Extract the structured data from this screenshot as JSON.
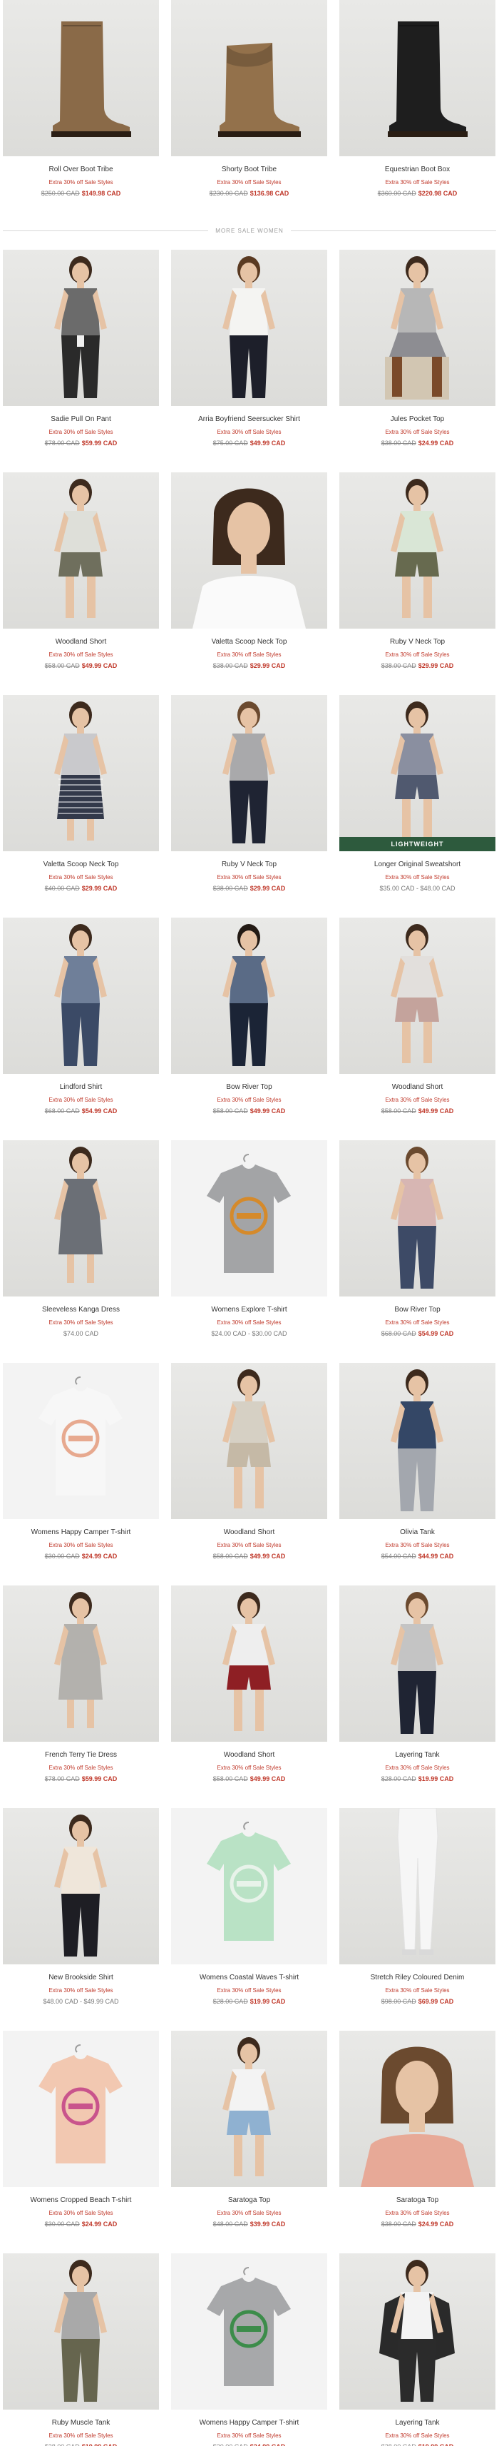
{
  "top_row": [
    {
      "name": "Roll Over Boot Tribe",
      "promo": "Extra 30% off Sale Styles",
      "was": "$250.00 CAD",
      "now": "$149.98 CAD",
      "image": "boot-brown"
    },
    {
      "name": "Shorty Boot Tribe",
      "promo": "Extra 30% off Sale Styles",
      "was": "$230.00 CAD",
      "now": "$136.98 CAD",
      "image": "boot-brown-short"
    },
    {
      "name": "Equestrian Boot Box",
      "promo": "Extra 30% off Sale Styles",
      "was": "$360.00 CAD",
      "now": "$220.98 CAD",
      "image": "boot-black"
    }
  ],
  "section_divider": "MORE SALE WOMEN",
  "products": [
    {
      "name": "Sadie Pull On Pant",
      "promo": "Extra 30% off Sale Styles",
      "was": "$78.00 CAD",
      "now": "$59.99 CAD",
      "image": "pant-black"
    },
    {
      "name": "Arria Boyfriend Seersucker Shirt",
      "promo": "Extra 30% off Sale Styles",
      "was": "$75.00 CAD",
      "now": "$49.99 CAD",
      "image": "shirt-white"
    },
    {
      "name": "Jules Pocket Top",
      "promo": "Extra 30% off Sale Styles",
      "was": "$38.00 CAD",
      "now": "$24.99 CAD",
      "image": "top-grey"
    },
    {
      "name": "Woodland Short",
      "promo": "Extra 30% off Sale Styles",
      "was": "$58.00 CAD",
      "now": "$49.99 CAD",
      "image": "short-olive"
    },
    {
      "name": "Valetta Scoop Neck Top",
      "promo": "Extra 30% off Sale Styles",
      "was": "$38.00 CAD",
      "now": "$29.99 CAD",
      "image": "top-white"
    },
    {
      "name": "Ruby V Neck Top",
      "promo": "Extra 30% off Sale Styles",
      "was": "$38.00 CAD",
      "now": "$29.99 CAD",
      "image": "top-mint"
    },
    {
      "name": "Valetta Scoop Neck Top",
      "promo": "Extra 30% off Sale Styles",
      "was": "$40.00 CAD",
      "now": "$29.99 CAD",
      "image": "top-grey-stripe-skirt"
    },
    {
      "name": "Ruby V Neck Top",
      "promo": "Extra 30% off Sale Styles",
      "was": "$38.00 CAD",
      "now": "$29.99 CAD",
      "image": "top-grey-vneck"
    },
    {
      "name": "Longer Original Sweatshort",
      "promo": "Extra 30% off Sale Styles",
      "plain_price": "$35.00 CAD - $48.00 CAD",
      "badge": "LIGHTWEIGHT",
      "image": "sweatshort-navy"
    },
    {
      "name": "Lindford Shirt",
      "promo": "Extra 30% off Sale Styles",
      "was": "$68.00 CAD",
      "now": "$54.99 CAD",
      "image": "shirt-plaid-blue"
    },
    {
      "name": "Bow River Top",
      "promo": "Extra 30% off Sale Styles",
      "was": "$58.00 CAD",
      "now": "$49.99 CAD",
      "image": "top-plaid-navy"
    },
    {
      "name": "Woodland Short",
      "promo": "Extra 30% off Sale Styles",
      "was": "$58.00 CAD",
      "now": "$49.99 CAD",
      "image": "short-plaid-pink"
    },
    {
      "name": "Sleeveless Kanga Dress",
      "promo": "Extra 30% off Sale Styles",
      "plain_price": "$74.00 CAD",
      "image": "dress-grey"
    },
    {
      "name": "Womens Explore T-shirt",
      "promo": "Extra 30% off Sale Styles",
      "plain_price": "$24.00 CAD - $30.00 CAD",
      "image": "tee-grey-graphic"
    },
    {
      "name": "Bow River Top",
      "promo": "Extra 30% off Sale Styles",
      "was": "$68.00 CAD",
      "now": "$54.99 CAD",
      "image": "top-plaid-pink"
    },
    {
      "name": "Womens Happy Camper T-shirt",
      "promo": "Extra 30% off Sale Styles",
      "was": "$30.00 CAD",
      "now": "$24.99 CAD",
      "image": "tee-white-graphic"
    },
    {
      "name": "Woodland Short",
      "promo": "Extra 30% off Sale Styles",
      "was": "$58.00 CAD",
      "now": "$49.99 CAD",
      "image": "short-stone"
    },
    {
      "name": "Olivia Tank",
      "promo": "Extra 30% off Sale Styles",
      "was": "$54.00 CAD",
      "now": "$44.99 CAD",
      "image": "tank-navy-dot"
    },
    {
      "name": "French Terry Tie Dress",
      "promo": "Extra 30% off Sale Styles",
      "was": "$78.00 CAD",
      "now": "$59.99 CAD",
      "image": "dress-heather"
    },
    {
      "name": "Woodland Short",
      "promo": "Extra 30% off Sale Styles",
      "was": "$58.00 CAD",
      "now": "$49.99 CAD",
      "image": "short-red"
    },
    {
      "name": "Layering Tank",
      "promo": "Extra 30% off Sale Styles",
      "was": "$28.00 CAD",
      "now": "$19.99 CAD",
      "image": "tank-grey"
    },
    {
      "name": "New Brookside Shirt",
      "promo": "Extra 30% off Sale Styles",
      "plain_price": "$48.00 CAD - $49.99 CAD",
      "image": "shirt-print"
    },
    {
      "name": "Womens Coastal Waves T-shirt",
      "promo": "Extra 30% off Sale Styles",
      "was": "$28.00 CAD",
      "now": "$19.99 CAD",
      "image": "tee-mint-graphic"
    },
    {
      "name": "Stretch Riley Coloured Denim",
      "promo": "Extra 30% off Sale Styles",
      "was": "$98.00 CAD",
      "now": "$69.99 CAD",
      "image": "denim-white"
    },
    {
      "name": "Womens Cropped Beach T-shirt",
      "promo": "Extra 30% off Sale Styles",
      "was": "$30.00 CAD",
      "now": "$24.99 CAD",
      "image": "tee-peach-graphic"
    },
    {
      "name": "Saratoga Top",
      "promo": "Extra 30% off Sale Styles",
      "was": "$48.00 CAD",
      "now": "$39.99 CAD",
      "image": "top-white-denim-short"
    },
    {
      "name": "Saratoga Top",
      "promo": "Extra 30% off Sale Styles",
      "was": "$38.00 CAD",
      "now": "$24.99 CAD",
      "image": "top-coral"
    },
    {
      "name": "Ruby Muscle Tank",
      "promo": "Extra 30% off Sale Styles",
      "was": "$28.00 CAD",
      "now": "$19.99 CAD",
      "image": "tank-heather-olive"
    },
    {
      "name": "Womens Happy Camper T-shirt",
      "promo": "Extra 30% off Sale Styles",
      "was": "$30.00 CAD",
      "now": "$24.99 CAD",
      "image": "tee-grey-rainbow"
    },
    {
      "name": "Layering Tank",
      "promo": "Extra 30% off Sale Styles",
      "was": "$28.00 CAD",
      "now": "$19.99 CAD",
      "image": "tank-white-jacket"
    }
  ],
  "colors": {
    "sale_red": "#c0392b",
    "badge_green": "#2d5a3d",
    "divider": "#d6d6d6"
  }
}
